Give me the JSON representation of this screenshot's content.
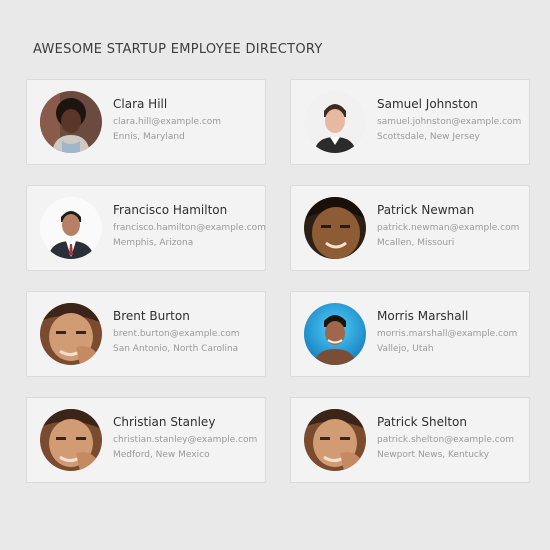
{
  "page": {
    "title": "AWESOME STARTUP EMPLOYEE DIRECTORY"
  },
  "employees": [
    {
      "name": "Clara Hill",
      "email": "clara.hill@example.com",
      "location": "Ennis, Maryland",
      "avatar_icon": "woman-portrait"
    },
    {
      "name": "Samuel Johnston",
      "email": "samuel.johnston@example.com",
      "location": "Scottsdale, New Jersey",
      "avatar_icon": "man-portrait-white-bg"
    },
    {
      "name": "Francisco Hamilton",
      "email": "francisco.hamilton@example.com",
      "location": "Memphis, Arizona",
      "avatar_icon": "man-portrait-suit"
    },
    {
      "name": "Patrick Newman",
      "email": "patrick.newman@example.com",
      "location": "Mcallen, Missouri",
      "avatar_icon": "man-portrait-closeup"
    },
    {
      "name": "Brent Burton",
      "email": "brent.burton@example.com",
      "location": "San Antonio, North Carolina",
      "avatar_icon": "man-portrait-hand"
    },
    {
      "name": "Morris Marshall",
      "email": "morris.marshall@example.com",
      "location": "Vallejo, Utah",
      "avatar_icon": "man-portrait-blue-bg"
    },
    {
      "name": "Christian Stanley",
      "email": "christian.stanley@example.com",
      "location": "Medford, New Mexico",
      "avatar_icon": "man-portrait-hand"
    },
    {
      "name": "Patrick Shelton",
      "email": "patrick.shelton@example.com",
      "location": "Newport News, Kentucky",
      "avatar_icon": "man-portrait-hand"
    }
  ]
}
